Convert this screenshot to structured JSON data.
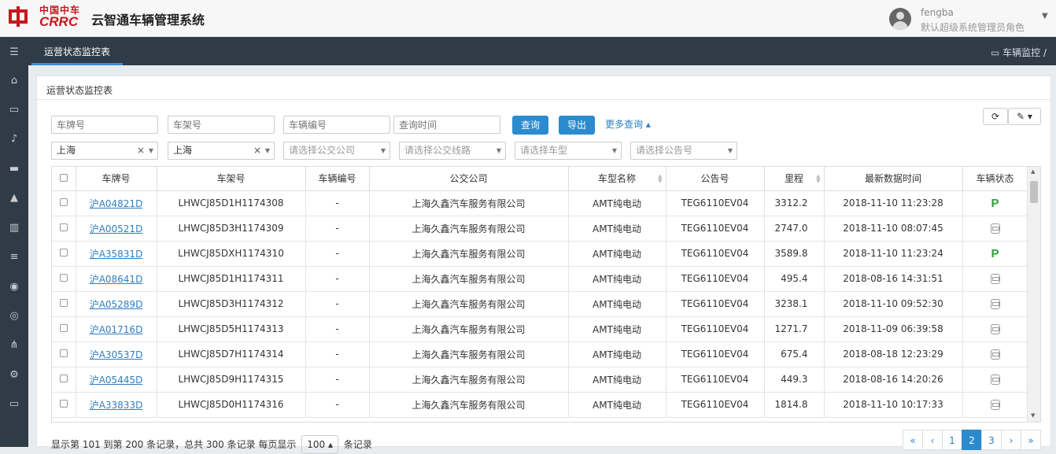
{
  "brand": {
    "cn": "中国中车",
    "en": "CRRC",
    "system_name": "云智通车辆管理系统"
  },
  "user": {
    "name": "fengba",
    "role": "默认超级系统管理员角色"
  },
  "nav": {
    "active_tab": "运营状态监控表",
    "breadcrumb": "车辆监控",
    "breadcrumb_sep": "/"
  },
  "sidebar": {
    "icons": [
      "menu-icon",
      "home-icon",
      "laptop-icon",
      "bell-icon",
      "car-icon",
      "warning-icon",
      "chart-icon",
      "list-icon",
      "dashboard-icon",
      "database-icon",
      "sitemap-icon",
      "gear-icon",
      "monitor-icon"
    ]
  },
  "panel": {
    "title": "运营状态监控表"
  },
  "filters": {
    "plate_placeholder": "车牌号",
    "frame_placeholder": "车架号",
    "vehicle_no_placeholder": "车辆编号",
    "time_placeholder": "查询时间",
    "query_label": "查询",
    "export_label": "导出",
    "more_label": "更多查询 ▴",
    "city": "上海",
    "city2": "上海",
    "company_placeholder": "请选择公交公司",
    "line_placeholder": "请选择公交线路",
    "model_placeholder": "请选择车型",
    "notice_placeholder": "请选择公告号"
  },
  "table": {
    "headers": [
      "车牌号",
      "车架号",
      "车辆编号",
      "公交公司",
      "车型名称",
      "公告号",
      "里程",
      "最新数据时间",
      "车辆状态"
    ],
    "rows": [
      {
        "plate": "沪A04821D",
        "frame": "LHWCJ85D1H1174308",
        "no": "-",
        "company": "上海久鑫汽车服务有限公司",
        "model": "AMT纯电动",
        "notice": "TEG6110EV04",
        "mileage": "3312.2",
        "time": "2018-11-10 11:23:28",
        "status": "P"
      },
      {
        "plate": "沪A00521D",
        "frame": "LHWCJ85D3H1174309",
        "no": "-",
        "company": "上海久鑫汽车服务有限公司",
        "model": "AMT纯电动",
        "notice": "TEG6110EV04",
        "mileage": "2747.0",
        "time": "2018-11-10 08:07:45",
        "status": "bus"
      },
      {
        "plate": "沪A35831D",
        "frame": "LHWCJ85DXH1174310",
        "no": "-",
        "company": "上海久鑫汽车服务有限公司",
        "model": "AMT纯电动",
        "notice": "TEG6110EV04",
        "mileage": "3589.8",
        "time": "2018-11-10 11:23:24",
        "status": "P"
      },
      {
        "plate": "沪A08641D",
        "frame": "LHWCJ85D1H1174311",
        "no": "-",
        "company": "上海久鑫汽车服务有限公司",
        "model": "AMT纯电动",
        "notice": "TEG6110EV04",
        "mileage": "495.4",
        "time": "2018-08-16 14:31:51",
        "status": "bus"
      },
      {
        "plate": "沪A05289D",
        "frame": "LHWCJ85D3H1174312",
        "no": "-",
        "company": "上海久鑫汽车服务有限公司",
        "model": "AMT纯电动",
        "notice": "TEG6110EV04",
        "mileage": "3238.1",
        "time": "2018-11-10 09:52:30",
        "status": "bus"
      },
      {
        "plate": "沪A01716D",
        "frame": "LHWCJ85D5H1174313",
        "no": "-",
        "company": "上海久鑫汽车服务有限公司",
        "model": "AMT纯电动",
        "notice": "TEG6110EV04",
        "mileage": "1271.7",
        "time": "2018-11-09 06:39:58",
        "status": "bus"
      },
      {
        "plate": "沪A30537D",
        "frame": "LHWCJ85D7H1174314",
        "no": "-",
        "company": "上海久鑫汽车服务有限公司",
        "model": "AMT纯电动",
        "notice": "TEG6110EV04",
        "mileage": "675.4",
        "time": "2018-08-18 12:23:29",
        "status": "bus"
      },
      {
        "plate": "沪A05445D",
        "frame": "LHWCJ85D9H1174315",
        "no": "-",
        "company": "上海久鑫汽车服务有限公司",
        "model": "AMT纯电动",
        "notice": "TEG6110EV04",
        "mileage": "449.3",
        "time": "2018-08-16 14:20:26",
        "status": "bus"
      },
      {
        "plate": "沪A33833D",
        "frame": "LHWCJ85D0H1174316",
        "no": "-",
        "company": "上海久鑫汽车服务有限公司",
        "model": "AMT纯电动",
        "notice": "TEG6110EV04",
        "mileage": "1814.8",
        "time": "2018-11-10 10:17:33",
        "status": "bus"
      }
    ]
  },
  "footer": {
    "text_before": "显示第 101 到第 200 条记录，总共 300 条记录 每页显示",
    "page_size": "100 ▴",
    "text_after": "条记录"
  },
  "pagination": {
    "items": [
      "«",
      "‹",
      "1",
      "2",
      "3",
      "›",
      "»"
    ],
    "active": "2"
  },
  "colors": {
    "accent": "#2c8bce",
    "sidebar": "#2f3b46",
    "brand_red": "#c8161d",
    "status_parked": "#2e9e3a"
  }
}
